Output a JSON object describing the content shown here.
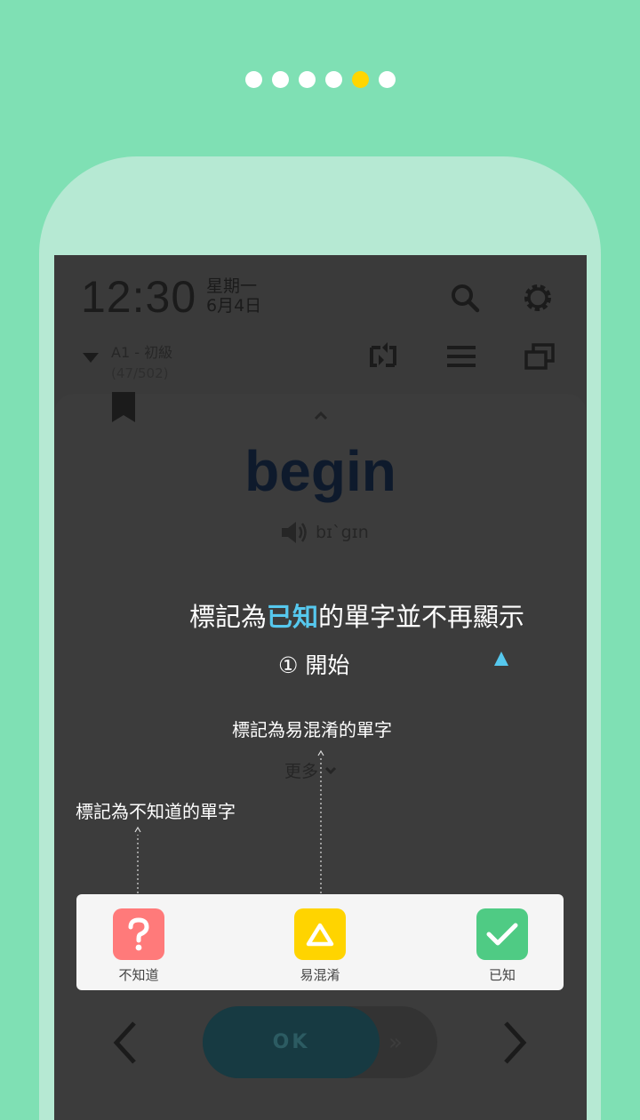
{
  "carousel": {
    "count": 6,
    "active_index": 4
  },
  "status": {
    "time": "12:30",
    "weekday": "星期一",
    "date": "6月4日"
  },
  "level": {
    "name": "A1 - 初級",
    "progress": "(47/502)"
  },
  "word": {
    "text": "begin",
    "phonetic": "bɪˋgɪn"
  },
  "hints": {
    "known_prefix": "標記為",
    "known_highlight": "已知",
    "known_suffix": "的單字並不再顯示",
    "confusing": "標記為易混淆的單字",
    "unknown": "標記為不知道的單字"
  },
  "meaning": "① 開始",
  "more": "更多",
  "actions": {
    "unknown": {
      "label": "不知道",
      "color": "#ff7a7a"
    },
    "confusing": {
      "label": "易混淆",
      "color": "#ffd400"
    },
    "known": {
      "label": "已知",
      "color": "#4fcb84"
    }
  },
  "ok_label": "OK",
  "colors": {
    "background": "#7fe0b4",
    "phone_frame": "#b6e9d3",
    "screen": "#3a3a3a",
    "highlight": "#56c8ee"
  }
}
